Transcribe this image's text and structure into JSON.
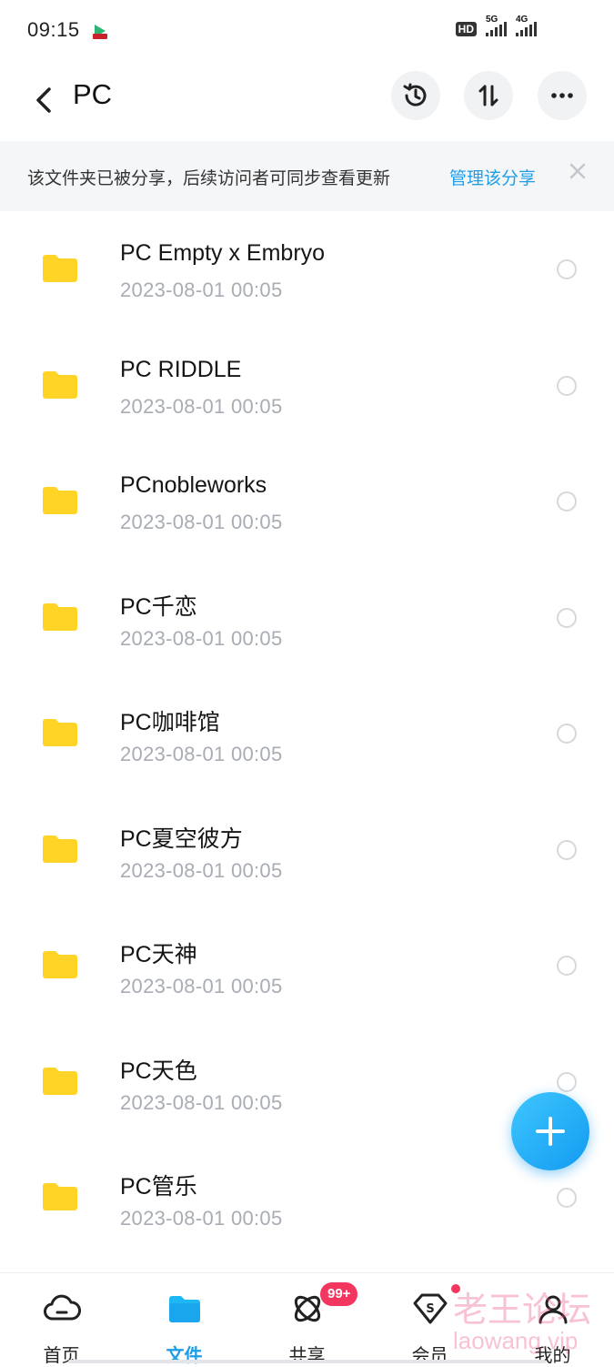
{
  "status_bar": {
    "time": "09:15",
    "hd_label": "HD",
    "net1_label": "5G",
    "net2_label": "4G"
  },
  "header": {
    "title": "PC"
  },
  "banner": {
    "message": "该文件夹已被分享，后续访问者可同步查看更新",
    "manage_label": "管理该分享"
  },
  "files": [
    {
      "name": "PC Empty x Embryo",
      "date": "2023-08-01  00:05"
    },
    {
      "name": "PC RIDDLE",
      "date": "2023-08-01  00:05"
    },
    {
      "name": "PCnobleworks",
      "date": "2023-08-01  00:05"
    },
    {
      "name": "PC千恋",
      "date": "2023-08-01  00:05"
    },
    {
      "name": "PC咖啡馆",
      "date": "2023-08-01  00:05"
    },
    {
      "name": "PC夏空彼方",
      "date": "2023-08-01  00:05"
    },
    {
      "name": "PC天神",
      "date": "2023-08-01  00:05"
    },
    {
      "name": "PC天色",
      "date": "2023-08-01  00:05"
    },
    {
      "name": "PC管乐",
      "date": "2023-08-01  00:05"
    }
  ],
  "tabs": [
    {
      "label": "首页",
      "icon": "cloud-icon"
    },
    {
      "label": "文件",
      "icon": "folder-icon"
    },
    {
      "label": "共享",
      "icon": "share-atom-icon"
    },
    {
      "label": "会员",
      "icon": "diamond-icon"
    },
    {
      "label": "我的",
      "icon": "profile-icon"
    }
  ],
  "share_badge": "99+",
  "watermark": {
    "line1": "老王论坛",
    "line2": "laowang.vip"
  },
  "colors": {
    "accent": "#1f9ee8",
    "folder": "#ffd426",
    "badge": "#f3365f"
  }
}
